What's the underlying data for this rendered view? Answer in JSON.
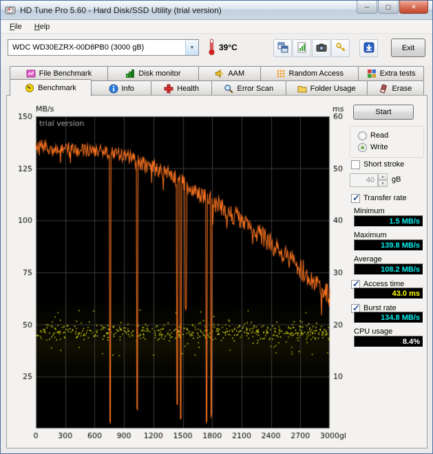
{
  "window": {
    "title": "HD Tune Pro 5.60 - Hard Disk/SSD Utility (trial version)",
    "controls": {
      "minimize": "─",
      "maximize": "▢",
      "close": "✕"
    }
  },
  "menu": {
    "items": [
      {
        "label": "File"
      },
      {
        "label": "Help"
      }
    ]
  },
  "toolbar": {
    "drive_selected": "WDC WD30EZRX-00D8PB0 (3000 gB)",
    "dropdown_arrow": "▼",
    "temperature": "39°C",
    "icons": [
      "copy-window-icon",
      "copy-chart-icon",
      "camera-icon",
      "keys-icon",
      "save-download-icon"
    ],
    "exit_label": "Exit"
  },
  "tabs": {
    "row1": [
      {
        "label": "File Benchmark",
        "icon": "file-benchmark-icon"
      },
      {
        "label": "Disk monitor",
        "icon": "disk-monitor-icon"
      },
      {
        "label": "AAM",
        "icon": "aam-icon"
      },
      {
        "label": "Random Access",
        "icon": "random-access-icon"
      },
      {
        "label": "Extra tests",
        "icon": "extra-tests-icon"
      }
    ],
    "row2": [
      {
        "label": "Benchmark",
        "icon": "benchmark-icon",
        "active": true
      },
      {
        "label": "Info",
        "icon": "info-icon"
      },
      {
        "label": "Health",
        "icon": "health-icon"
      },
      {
        "label": "Error Scan",
        "icon": "error-scan-icon"
      },
      {
        "label": "Folder Usage",
        "icon": "folder-usage-icon"
      },
      {
        "label": "Erase",
        "icon": "erase-icon"
      }
    ]
  },
  "panel": {
    "start_label": "Start",
    "mode": {
      "read_label": "Read",
      "write_label": "Write",
      "selected": "Write"
    },
    "short_stroke": {
      "label": "Short stroke",
      "checked": false,
      "value": "40",
      "unit": "gB"
    },
    "transfer_rate": {
      "label": "Transfer rate",
      "checked": true,
      "minimum_label": "Minimum",
      "minimum_value": "1.5 MB/s",
      "maximum_label": "Maximum",
      "maximum_value": "139.8 MB/s",
      "average_label": "Average",
      "average_value": "108.2 MB/s"
    },
    "access_time": {
      "label": "Access time",
      "checked": true,
      "value": "43.0 ms"
    },
    "burst_rate": {
      "label": "Burst rate",
      "checked": true,
      "value": "134.8 MB/s"
    },
    "cpu_usage": {
      "label": "CPU usage",
      "value": "8.4%"
    },
    "value_color_rate": "#00f0f0",
    "value_color_time": "#ffff00",
    "value_color_cpu": "#ffffff"
  },
  "chart_data": {
    "type": "line",
    "watermark": "trial version",
    "plot_bg": "#000000",
    "grid_color": "#3d3d3d",
    "border_color": "#8a8a8a",
    "x_axis": {
      "min": 0,
      "max": 3000,
      "unit": "gB",
      "ticks": [
        0,
        300,
        600,
        900,
        1200,
        1500,
        1800,
        2100,
        2400,
        2700,
        3000
      ]
    },
    "y_left": {
      "label": "MB/s",
      "min": 0,
      "max": 150,
      "ticks": [
        25,
        50,
        75,
        100,
        125,
        150
      ]
    },
    "y_right": {
      "label": "ms",
      "min": 0,
      "max": 60,
      "ticks": [
        10,
        20,
        30,
        40,
        50,
        60
      ]
    },
    "transfer_rate_series": {
      "name": "Transfer rate (Write)",
      "color": "#f8721f",
      "keypoints": [
        [
          0,
          135
        ],
        [
          60,
          137
        ],
        [
          150,
          134
        ],
        [
          300,
          135
        ],
        [
          450,
          134
        ],
        [
          600,
          133
        ],
        [
          750,
          133
        ],
        [
          900,
          131
        ],
        [
          1000,
          129
        ],
        [
          1100,
          127
        ],
        [
          1200,
          125
        ],
        [
          1300,
          123
        ],
        [
          1400,
          121
        ],
        [
          1500,
          118
        ],
        [
          1600,
          115
        ],
        [
          1700,
          112
        ],
        [
          1800,
          109
        ],
        [
          1900,
          106
        ],
        [
          2000,
          103
        ],
        [
          2100,
          100
        ],
        [
          2200,
          96
        ],
        [
          2300,
          93
        ],
        [
          2400,
          89
        ],
        [
          2500,
          85
        ],
        [
          2600,
          81
        ],
        [
          2700,
          77
        ],
        [
          2800,
          73
        ],
        [
          2900,
          68
        ],
        [
          3000,
          63
        ]
      ],
      "oscillation": {
        "amplitude_start": 2.5,
        "amplitude_end": 5.5,
        "sample_step_gb": 6
      },
      "spikes": [
        [
          760,
          2
        ],
        [
          1035,
          8
        ],
        [
          1445,
          10
        ],
        [
          1478,
          3
        ],
        [
          1530,
          57
        ],
        [
          1745,
          2
        ],
        [
          1792,
          5
        ]
      ],
      "min": 1.5,
      "max": 139.8,
      "avg": 108.2
    },
    "access_time_scatter": {
      "name": "Access time",
      "color": "#ffff2e",
      "color_dim": "#d6d600",
      "count": 520,
      "center_ms": 18.6,
      "spread_ms": 1.7,
      "outlier_fraction": 0.12,
      "outlier_min_ms": 14,
      "outlier_max_ms": 23
    }
  }
}
